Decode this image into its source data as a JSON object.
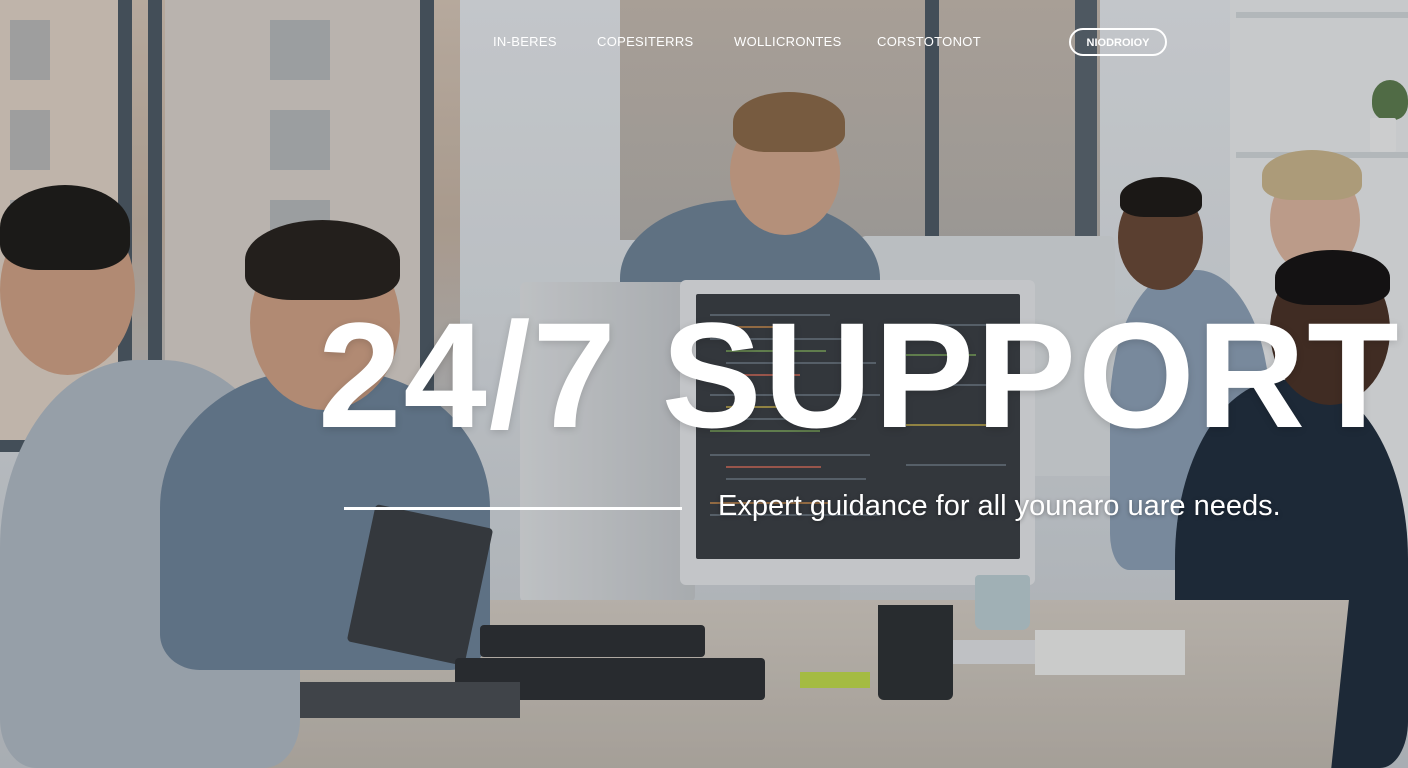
{
  "nav": {
    "links": [
      "IN-BERES",
      "COPESITERRS",
      "WOLLICRONTES",
      "CORSTOTONOT"
    ],
    "cta_label": "NIODROIOY"
  },
  "hero": {
    "headline": "24/7 SUPPORT",
    "tagline": "Expert guidance for all younaro uare needs."
  },
  "colors": {
    "text": "#ffffff",
    "divider": "#ffffff"
  }
}
